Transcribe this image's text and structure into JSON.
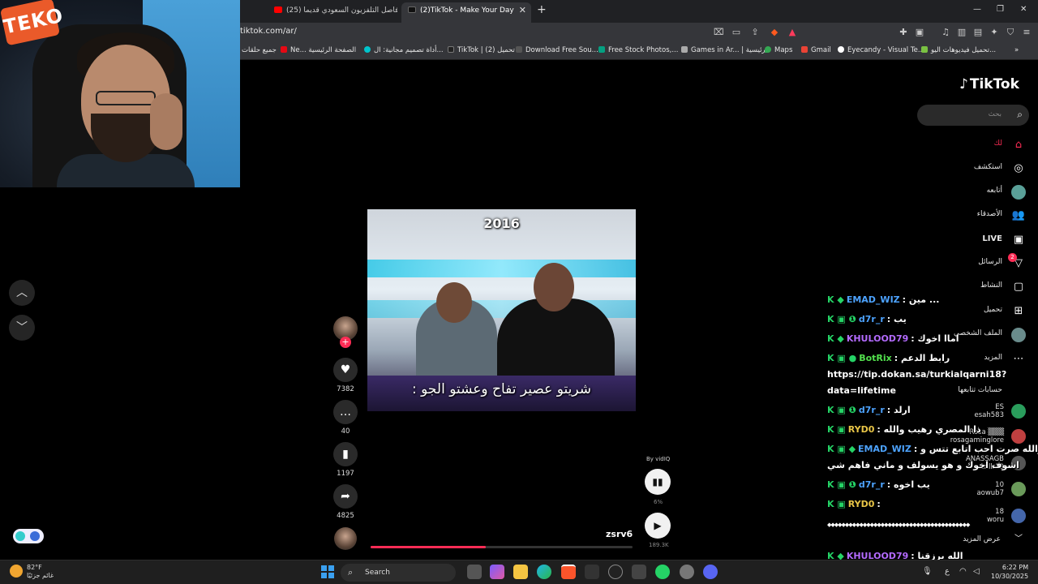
{
  "browser": {
    "tabs": [
      {
        "label": "(25) فاصل التلفزيون السعودي قديما - ...",
        "favicon_color": "#ff0000"
      },
      {
        "label": "(2)TikTok - Make Your Day",
        "favicon_color": "#111111"
      }
    ],
    "url": "tiktok.com/ar/",
    "bookmarks": [
      {
        "label": "جميع حلقات",
        "color": "#777777"
      },
      {
        "label": "Ne... الصفحة الرئيسية",
        "color": "#e50914"
      },
      {
        "label": "أداة تصميم مجانية: ال...",
        "color": "#00c4cc"
      },
      {
        "label": "TikTok | تحميل (2)",
        "color": "#222222"
      },
      {
        "label": "Download Free Sou...",
        "color": "#555555"
      },
      {
        "label": "Free Stock Photos,...",
        "color": "#05a081"
      },
      {
        "label": "Games in Ar... | رئيسية",
        "color": "#aaaaaa"
      },
      {
        "label": "Maps",
        "color": "#34a853"
      },
      {
        "label": "Gmail",
        "color": "#ea4335"
      },
      {
        "label": "Eyecandy - Visual Te...",
        "color": "#ffffff"
      },
      {
        "label": "تحميل فيديوهات اليو...",
        "color": "#7ac142"
      }
    ]
  },
  "webcam": {
    "logo_text": "TEKO"
  },
  "video": {
    "overlay_year": "2016",
    "subtitle": "شريتو عصير تفاح وعشتو الجو :",
    "author": "zsrv6",
    "by_label": "By vidIQ",
    "vidiq_percent": "6%",
    "views": "189.3K",
    "progress": 0.44
  },
  "engagement": {
    "likes": "7382",
    "comments": "40",
    "saves": "1197",
    "shares": "4825"
  },
  "sidebar": {
    "brand": "TikTok",
    "search_placeholder": "بحث",
    "items": [
      {
        "label": "لك",
        "icon": "home-icon",
        "glyph": "⌂",
        "active": true
      },
      {
        "label": "استكشف",
        "icon": "compass-icon",
        "glyph": "◎"
      },
      {
        "label": "أتابعه",
        "icon": "following-avatar-icon",
        "glyph": "●"
      },
      {
        "label": "الأصدقاء",
        "icon": "friends-icon",
        "glyph": "👥"
      },
      {
        "label": "LIVE",
        "icon": "live-icon",
        "glyph": "▣"
      },
      {
        "label": "الرسائل",
        "icon": "messages-icon",
        "glyph": "▽",
        "badge": "2"
      },
      {
        "label": "النشاط",
        "icon": "activity-icon",
        "glyph": "▢"
      },
      {
        "label": "تحميل",
        "icon": "upload-icon",
        "glyph": "⊞"
      },
      {
        "label": "الملف الشخصي",
        "icon": "profile-icon",
        "glyph": "●"
      },
      {
        "label": "المزيد",
        "icon": "more-icon",
        "glyph": "⋯"
      }
    ],
    "following_title": "حسابات تتابعها",
    "following": [
      {
        "display": "ES",
        "handle": "esah583",
        "color": "#2a9d5c"
      },
      {
        "display": "Rosa ▒▒▒",
        "handle": "rosagaminglore",
        "color": "#c04040"
      },
      {
        "display": "ANASSAGB",
        "handle": "znllr19",
        "color": "#555555"
      },
      {
        "display": "10",
        "handle": "aowub7",
        "color": "#6a9a5a"
      },
      {
        "display": "18",
        "handle": "woru",
        "color": "#4466aa"
      }
    ],
    "see_more": "عرض المزيد"
  },
  "chat": [
    {
      "name": "EMAD_WIZ",
      "name_color": "#4da3ff",
      "msg": ": مين ...",
      "badges": "K ◆"
    },
    {
      "name": "d7r_r",
      "name_color": "#4da3ff",
      "msg": ": يب",
      "badges": "K ▣ ❶"
    },
    {
      "name": "KHULOOD79",
      "name_color": "#b46bff",
      "msg": ": اماا اخوك",
      "badges": "K ◆"
    },
    {
      "name": "BotRix",
      "name_color": "#52e04d",
      "msg": ": رابط الدعم",
      "badges": "K ▣ ●"
    },
    {
      "name": "",
      "name_color": "#ffffff",
      "msg": "https://tip.dokan.sa/turkialqarni18?",
      "badges": ""
    },
    {
      "name": "",
      "name_color": "#ffffff",
      "msg": "data=lifetime",
      "badges": ""
    },
    {
      "name": "d7r_r",
      "name_color": "#4da3ff",
      "msg": ": ارلد",
      "badges": "K ▣ ❶"
    },
    {
      "name": "RYD0",
      "name_color": "#e8c547",
      "msg": ": ذا المصري رهيب والله",
      "badges": "K ▣"
    },
    {
      "name": "EMAD_WIZ",
      "name_color": "#4da3ff",
      "msg": ": والله صرت احب اتابع تتس و",
      "badges": "K ▣ ◆"
    },
    {
      "name": "",
      "name_color": "#ffffff",
      "msg": "اشوف اخوك و هو يسولف و ماني فاهم شي",
      "badges": ""
    },
    {
      "name": "d7r_r",
      "name_color": "#4da3ff",
      "msg": ": يب اخوه",
      "badges": "K ▣ ❶"
    },
    {
      "name": "RYD0",
      "name_color": "#e8c547",
      "msg": ":",
      "badges": "K ▣"
    },
    {
      "name": "",
      "name_color": "#ffffff",
      "msg": "◆◆◆◆◆◆◆◆◆◆◆◆◆◆◆◆◆◆◆◆◆◆◆◆◆◆◆◆◆◆◆◆◆◆◆◆◆◆◆◆",
      "badges": ""
    },
    {
      "name": "KHULOOD79",
      "name_color": "#b46bff",
      "msg": ": الله يرزقنا",
      "badges": "K ◆"
    },
    {
      "name": "",
      "name_color": "#ffffff",
      "msg": "◆◆◆◆◆◆◆◆◆◆◆◆◆◆◆◆◆◆◆◆◆◆◆◆◆◆◆◆◆◆◆◆◆◆◆◆◆◆◆◆",
      "badges": ""
    }
  ],
  "taskbar": {
    "weather_temp": "82°F",
    "weather_cond": "غائم جزئيًا",
    "search": "Search",
    "time": "6:22 PM",
    "date": "10/30/2025"
  }
}
